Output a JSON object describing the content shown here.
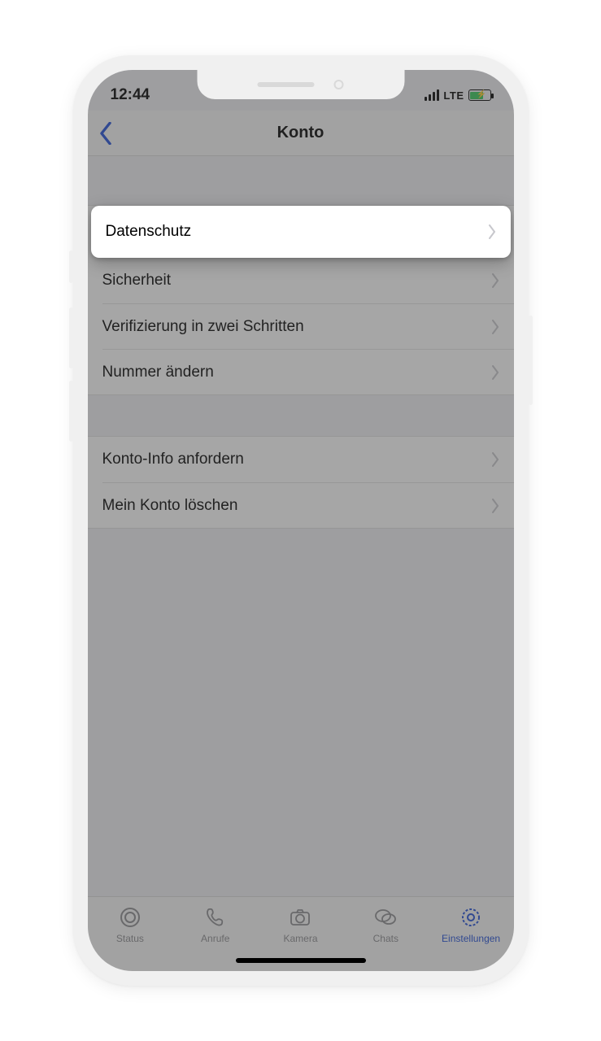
{
  "status": {
    "time": "12:44",
    "net": "LTE"
  },
  "header": {
    "title": "Konto"
  },
  "rows": {
    "privacy": "Datenschutz",
    "security": "Sicherheit",
    "two_step": "Verifizierung in zwei Schritten",
    "change_number": "Nummer ändern",
    "request_info": "Konto-Info anfordern",
    "delete": "Mein Konto löschen"
  },
  "tabs": {
    "status": "Status",
    "calls": "Anrufe",
    "camera": "Kamera",
    "chats": "Chats",
    "settings": "Einstellungen"
  }
}
